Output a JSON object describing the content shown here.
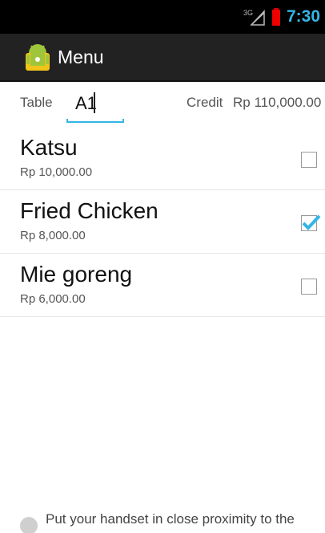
{
  "status_bar": {
    "signal_label": "3G",
    "time": "7:30",
    "accent_color": "#33b5e5"
  },
  "action_bar": {
    "icon": "android-icon",
    "title": "Menu"
  },
  "order": {
    "table_label": "Table",
    "table_value": "A1",
    "credit_label": "Credit",
    "credit_value": "Rp 110,000.00"
  },
  "menu": {
    "items": [
      {
        "name": "Katsu",
        "price": "Rp 10,000.00",
        "checked": false
      },
      {
        "name": "Fried Chicken",
        "price": "Rp 8,000.00",
        "checked": true
      },
      {
        "name": "Mie goreng",
        "price": "Rp 6,000.00",
        "checked": false
      }
    ]
  },
  "footer": {
    "icon": "nfc-icon",
    "hint": "Put your handset in close proximity to the"
  }
}
